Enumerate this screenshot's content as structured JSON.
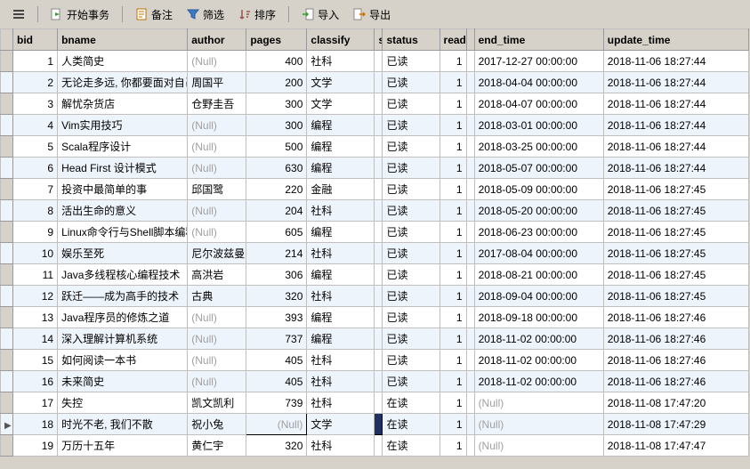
{
  "toolbar": {
    "start_tx": "开始事务",
    "note": "备注",
    "filter": "筛选",
    "sort": "排序",
    "import": "导入",
    "export": "导出"
  },
  "null_label": "(Null)",
  "columns": {
    "bid": "bid",
    "bname": "bname",
    "author": "author",
    "pages": "pages",
    "classify": "classify",
    "s": "s",
    "status": "status",
    "read": "read",
    "end_time": "end_time",
    "update_time": "update_time"
  },
  "selected_row": 18,
  "rows": [
    {
      "bid": 1,
      "bname": "人类简史",
      "author": null,
      "pages": 400,
      "classify": "社科",
      "status": "已读",
      "read": 1,
      "end_time": "2017-12-27 00:00:00",
      "update_time": "2018-11-06 18:27:44"
    },
    {
      "bid": 2,
      "bname": "无论走多远, 你都要面对自己",
      "author": "周国平",
      "pages": 200,
      "classify": "文学",
      "status": "已读",
      "read": 1,
      "end_time": "2018-04-04 00:00:00",
      "update_time": "2018-11-06 18:27:44"
    },
    {
      "bid": 3,
      "bname": "解忧杂货店",
      "author": "仓野圭吾",
      "pages": 300,
      "classify": "文学",
      "status": "已读",
      "read": 1,
      "end_time": "2018-04-07 00:00:00",
      "update_time": "2018-11-06 18:27:44"
    },
    {
      "bid": 4,
      "bname": "Vim实用技巧",
      "author": null,
      "pages": 300,
      "classify": "编程",
      "status": "已读",
      "read": 1,
      "end_time": "2018-03-01 00:00:00",
      "update_time": "2018-11-06 18:27:44"
    },
    {
      "bid": 5,
      "bname": "Scala程序设计",
      "author": null,
      "pages": 500,
      "classify": "编程",
      "status": "已读",
      "read": 1,
      "end_time": "2018-03-25 00:00:00",
      "update_time": "2018-11-06 18:27:44"
    },
    {
      "bid": 6,
      "bname": "Head First 设计模式",
      "author": null,
      "pages": 630,
      "classify": "编程",
      "status": "已读",
      "read": 1,
      "end_time": "2018-05-07 00:00:00",
      "update_time": "2018-11-06 18:27:44"
    },
    {
      "bid": 7,
      "bname": "投资中最简单的事",
      "author": "邱国鹭",
      "pages": 220,
      "classify": "金融",
      "status": "已读",
      "read": 1,
      "end_time": "2018-05-09 00:00:00",
      "update_time": "2018-11-06 18:27:45"
    },
    {
      "bid": 8,
      "bname": "活出生命的意义",
      "author": null,
      "pages": 204,
      "classify": "社科",
      "status": "已读",
      "read": 1,
      "end_time": "2018-05-20 00:00:00",
      "update_time": "2018-11-06 18:27:45"
    },
    {
      "bid": 9,
      "bname": "Linux命令行与Shell脚本编程",
      "author": null,
      "pages": 605,
      "classify": "编程",
      "status": "已读",
      "read": 1,
      "end_time": "2018-06-23 00:00:00",
      "update_time": "2018-11-06 18:27:45"
    },
    {
      "bid": 10,
      "bname": "娱乐至死",
      "author": "尼尔波兹曼",
      "pages": 214,
      "classify": "社科",
      "status": "已读",
      "read": 1,
      "end_time": "2017-08-04 00:00:00",
      "update_time": "2018-11-06 18:27:45"
    },
    {
      "bid": 11,
      "bname": "Java多线程核心编程技术",
      "author": "高洪岩",
      "pages": 306,
      "classify": "编程",
      "status": "已读",
      "read": 1,
      "end_time": "2018-08-21 00:00:00",
      "update_time": "2018-11-06 18:27:45"
    },
    {
      "bid": 12,
      "bname": "跃迁——成为高手的技术",
      "author": "古典",
      "pages": 320,
      "classify": "社科",
      "status": "已读",
      "read": 1,
      "end_time": "2018-09-04 00:00:00",
      "update_time": "2018-11-06 18:27:45"
    },
    {
      "bid": 13,
      "bname": "Java程序员的修炼之道",
      "author": null,
      "pages": 393,
      "classify": "编程",
      "status": "已读",
      "read": 1,
      "end_time": "2018-09-18 00:00:00",
      "update_time": "2018-11-06 18:27:46"
    },
    {
      "bid": 14,
      "bname": "深入理解计算机系统",
      "author": null,
      "pages": 737,
      "classify": "编程",
      "status": "已读",
      "read": 1,
      "end_time": "2018-11-02 00:00:00",
      "update_time": "2018-11-06 18:27:46"
    },
    {
      "bid": 15,
      "bname": "如何阅读一本书",
      "author": null,
      "pages": 405,
      "classify": "社科",
      "status": "已读",
      "read": 1,
      "end_time": "2018-11-02 00:00:00",
      "update_time": "2018-11-06 18:27:46"
    },
    {
      "bid": 16,
      "bname": "未来简史",
      "author": null,
      "pages": 405,
      "classify": "社科",
      "status": "已读",
      "read": 1,
      "end_time": "2018-11-02 00:00:00",
      "update_time": "2018-11-06 18:27:46"
    },
    {
      "bid": 17,
      "bname": "失控",
      "author": "凯文凯利",
      "pages": 739,
      "classify": "社科",
      "status": "在读",
      "read": 1,
      "end_time": null,
      "update_time": "2018-11-08 17:47:20"
    },
    {
      "bid": 18,
      "bname": "时光不老, 我们不散",
      "author": "祝小兔",
      "pages": null,
      "classify": "文学",
      "status": "在读",
      "read": 1,
      "end_time": null,
      "update_time": "2018-11-08 17:47:29"
    },
    {
      "bid": 19,
      "bname": "万历十五年",
      "author": "黄仁宇",
      "pages": 320,
      "classify": "社科",
      "status": "在读",
      "read": 1,
      "end_time": null,
      "update_time": "2018-11-08 17:47:47"
    }
  ]
}
